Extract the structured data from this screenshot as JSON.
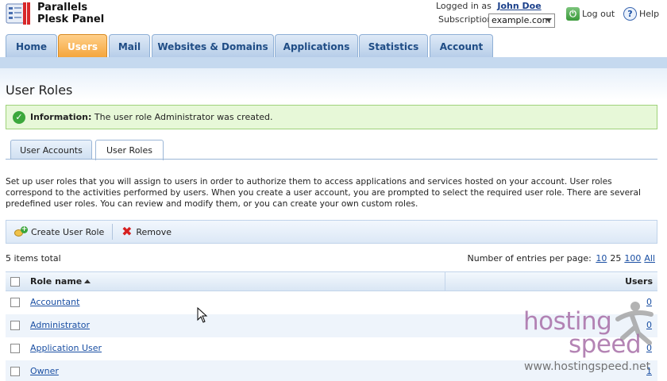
{
  "header": {
    "brand_line1": "Parallels",
    "brand_line2": "Plesk Panel",
    "logged_in_label": "Logged in as",
    "user_name": "John Doe",
    "subscription_label": "Subscription",
    "subscription_value": "example.com",
    "logout_label": "Log out",
    "help_label": "Help"
  },
  "main_tabs": [
    {
      "label": "Home",
      "active": false
    },
    {
      "label": "Users",
      "active": true
    },
    {
      "label": "Mail",
      "active": false
    },
    {
      "label": "Websites & Domains",
      "active": false
    },
    {
      "label": "Applications",
      "active": false
    },
    {
      "label": "Statistics",
      "active": false
    },
    {
      "label": "Account",
      "active": false
    }
  ],
  "page_title": "User Roles",
  "info": {
    "label": "Information:",
    "message": "The user role Administrator was created."
  },
  "sub_tabs": [
    {
      "label": "User Accounts",
      "active": false
    },
    {
      "label": "User Roles",
      "active": true
    }
  ],
  "description": "Set up user roles that you will assign to users in order to authorize them to access applications and services hosted on your account. User roles correspond to the activities performed by users. When you create a user account, you are prompted to select the required user role. There are several predefined user roles. You can review and modify them, or you can create your own custom roles.",
  "toolbar": {
    "create_label": "Create User Role",
    "remove_label": "Remove"
  },
  "list": {
    "total": "5 items total",
    "per_page_label": "Number of entries per page:",
    "per_page_options": [
      "10",
      "25",
      "100",
      "All"
    ],
    "per_page_current": "25",
    "col_name": "Role name",
    "col_users": "Users",
    "rows": [
      {
        "name": "Accountant",
        "users": "0"
      },
      {
        "name": "Administrator",
        "users": "0"
      },
      {
        "name": "Application User",
        "users": "0"
      },
      {
        "name": "Owner",
        "users": "1"
      }
    ]
  },
  "watermark": {
    "line1": "hosting",
    "line2": "speed",
    "url": "www.hostingspeed.net"
  },
  "colors": {
    "active_tab": "#f4a43a",
    "tab": "#b5cce8",
    "info_bg": "#e7f8d8",
    "link": "#1a4fa3"
  }
}
